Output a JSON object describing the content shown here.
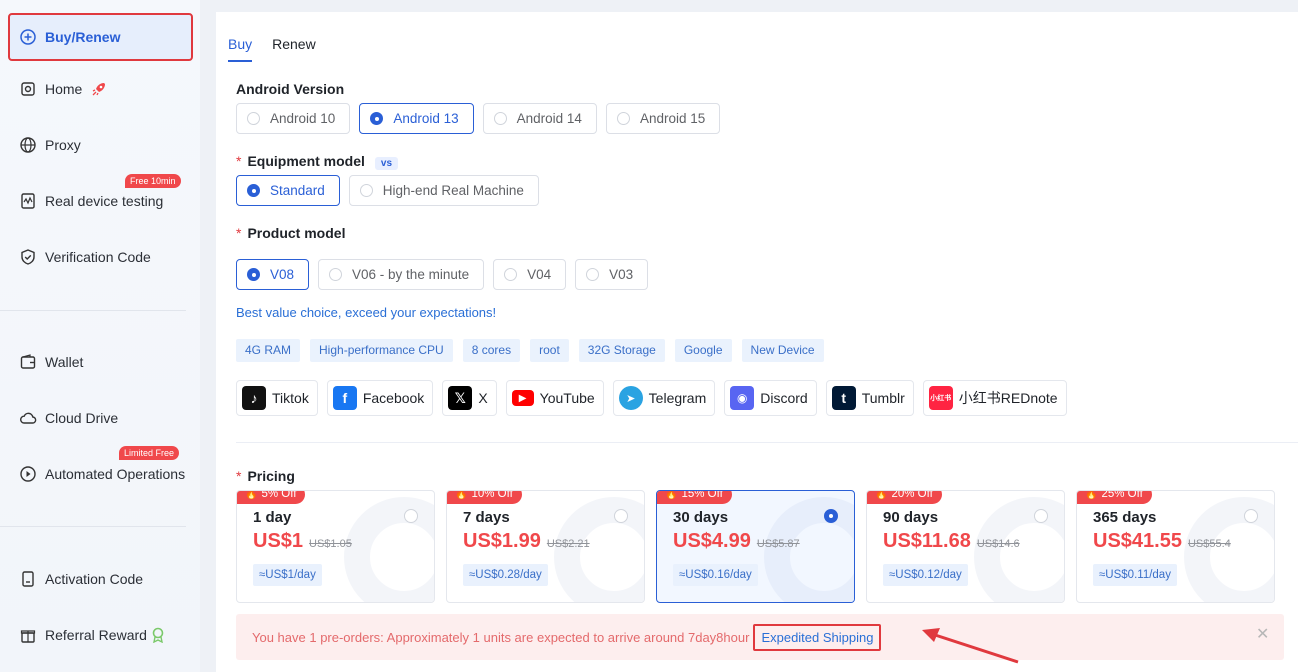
{
  "sidebar": {
    "items": [
      {
        "label": "Buy/Renew",
        "icon": "plus-circle-icon"
      },
      {
        "label": "Home",
        "icon": "home-icon"
      },
      {
        "label": "Proxy",
        "icon": "globe-icon"
      },
      {
        "label": "Real device testing",
        "icon": "device-test-icon",
        "badge": "Free 10min"
      },
      {
        "label": "Verification Code",
        "icon": "shield-icon"
      },
      {
        "label": "Wallet",
        "icon": "wallet-icon"
      },
      {
        "label": "Cloud Drive",
        "icon": "cloud-icon"
      },
      {
        "label": "Automated Operations",
        "icon": "automation-icon",
        "badge": "Limited Free"
      },
      {
        "label": "Activation Code",
        "icon": "key-icon"
      },
      {
        "label": "Referral Reward",
        "icon": "referral-icon"
      }
    ]
  },
  "tabs": {
    "buy": "Buy",
    "renew": "Renew"
  },
  "android": {
    "label": "Android Version",
    "options": [
      "Android 10",
      "Android 13",
      "Android 14",
      "Android 15"
    ],
    "selected": "Android 13"
  },
  "equipment": {
    "required": "*",
    "label": "Equipment model",
    "vs": "vs",
    "options": [
      "Standard",
      "High-end Real Machine"
    ],
    "selected": "Standard"
  },
  "product": {
    "required": "*",
    "label": "Product model",
    "options": [
      "V08",
      "V06 - by the minute",
      "V04",
      "V03"
    ],
    "selected": "V08",
    "tagline": "Best value choice, exceed your expectations!",
    "features": [
      "4G RAM",
      "High-performance CPU",
      "8 cores",
      "root",
      "32G Storage",
      "Google",
      "New Device"
    ]
  },
  "apps": [
    {
      "name": "Tiktok",
      "color": "#111111",
      "glyph": "♪"
    },
    {
      "name": "Facebook",
      "color": "#1877f2",
      "glyph": "f"
    },
    {
      "name": "X",
      "color": "#000000",
      "glyph": "𝕏"
    },
    {
      "name": "YouTube",
      "color": "#ff0000",
      "glyph": "▶"
    },
    {
      "name": "Telegram",
      "color": "#2aa3e2",
      "glyph": "➤"
    },
    {
      "name": "Discord",
      "color": "#5865f2",
      "glyph": "◉"
    },
    {
      "name": "Tumblr",
      "color": "#001935",
      "glyph": "t"
    },
    {
      "name": "小红书REDnote",
      "color": "#ff2442",
      "glyph": "小红书"
    }
  ],
  "pricing": {
    "required": "*",
    "label": "Pricing",
    "plans": [
      {
        "off": "5% Off",
        "days": "1 day",
        "price": "US$1",
        "orig": "US$1.05",
        "perday": "≈US$1/day"
      },
      {
        "off": "10% Off",
        "days": "7 days",
        "price": "US$1.99",
        "orig": "US$2.21",
        "perday": "≈US$0.28/day"
      },
      {
        "off": "15% Off",
        "days": "30 days",
        "price": "US$4.99",
        "orig": "US$5.87",
        "perday": "≈US$0.16/day"
      },
      {
        "off": "20% Off",
        "days": "90 days",
        "price": "US$11.68",
        "orig": "US$14.6",
        "perday": "≈US$0.12/day"
      },
      {
        "off": "25% Off",
        "days": "365 days",
        "price": "US$41.55",
        "orig": "US$55.4",
        "perday": "≈US$0.11/day"
      }
    ],
    "selected": "30 days"
  },
  "notice": {
    "text": "You have 1 pre-orders: Approximately 1 units are expected to arrive around 7day8hour",
    "link": "Expedited Shipping",
    "close": "✕"
  },
  "colors": {
    "accent": "#2a5fd6",
    "danger": "#f0484b",
    "highlight": "#e0393e"
  }
}
